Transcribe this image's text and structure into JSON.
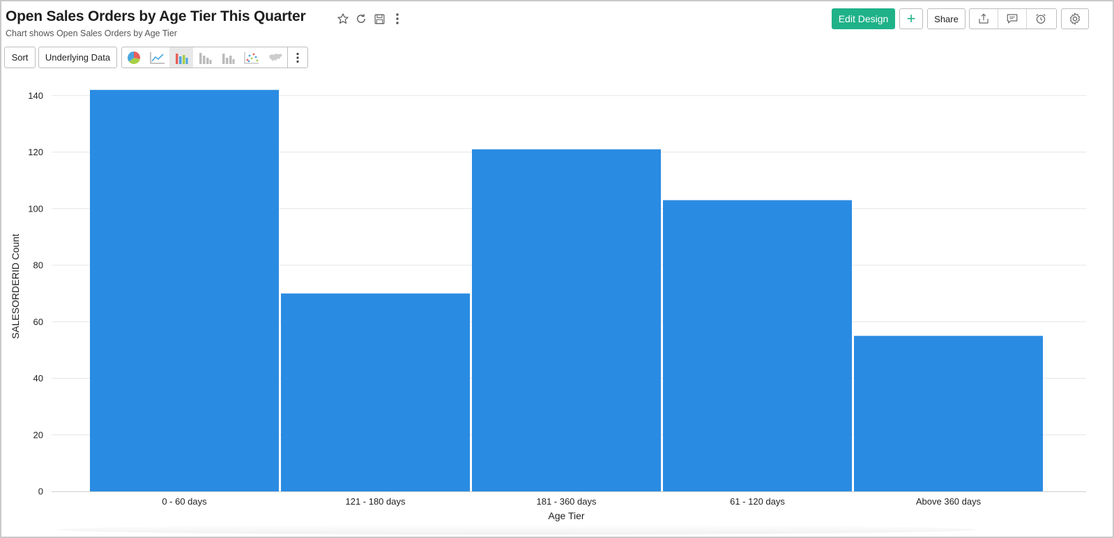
{
  "header": {
    "title": "Open Sales Orders by Age Tier This Quarter",
    "subtitle": "Chart shows Open Sales Orders by Age Tier",
    "icons": [
      "star-icon",
      "refresh-icon",
      "save-icon",
      "more-vertical-icon"
    ]
  },
  "toolbar": {
    "edit_design_label": "Edit Design",
    "add_label": "+",
    "share_label": "Share",
    "right_icons": [
      "export-icon",
      "comment-icon",
      "alarm-icon"
    ],
    "settings_icon": "gear-icon",
    "sort_label": "Sort",
    "underlying_data_label": "Underlying Data",
    "chart_type_icons": [
      "pie-chart-icon",
      "line-chart-icon",
      "bar-chart-icon",
      "stacked-bar-icon",
      "grouped-bar-icon",
      "scatter-icon",
      "map-icon"
    ],
    "active_chart_type": "bar-chart-icon"
  },
  "colors": {
    "bar": "#2a8be2",
    "accent": "#1fb289",
    "grid": "#e6e6e6"
  },
  "chart_data": {
    "type": "bar",
    "categories": [
      "0 - 60 days",
      "121 - 180 days",
      "181 - 360 days",
      "61 - 120 days",
      "Above 360 days"
    ],
    "values": [
      142,
      70,
      121,
      103,
      55
    ],
    "xlabel": "Age Tier",
    "ylabel": "SALESORDERID Count",
    "ylim": [
      0,
      145
    ],
    "yticks": [
      0,
      20,
      40,
      60,
      80,
      100,
      120,
      140
    ],
    "grid": true
  }
}
